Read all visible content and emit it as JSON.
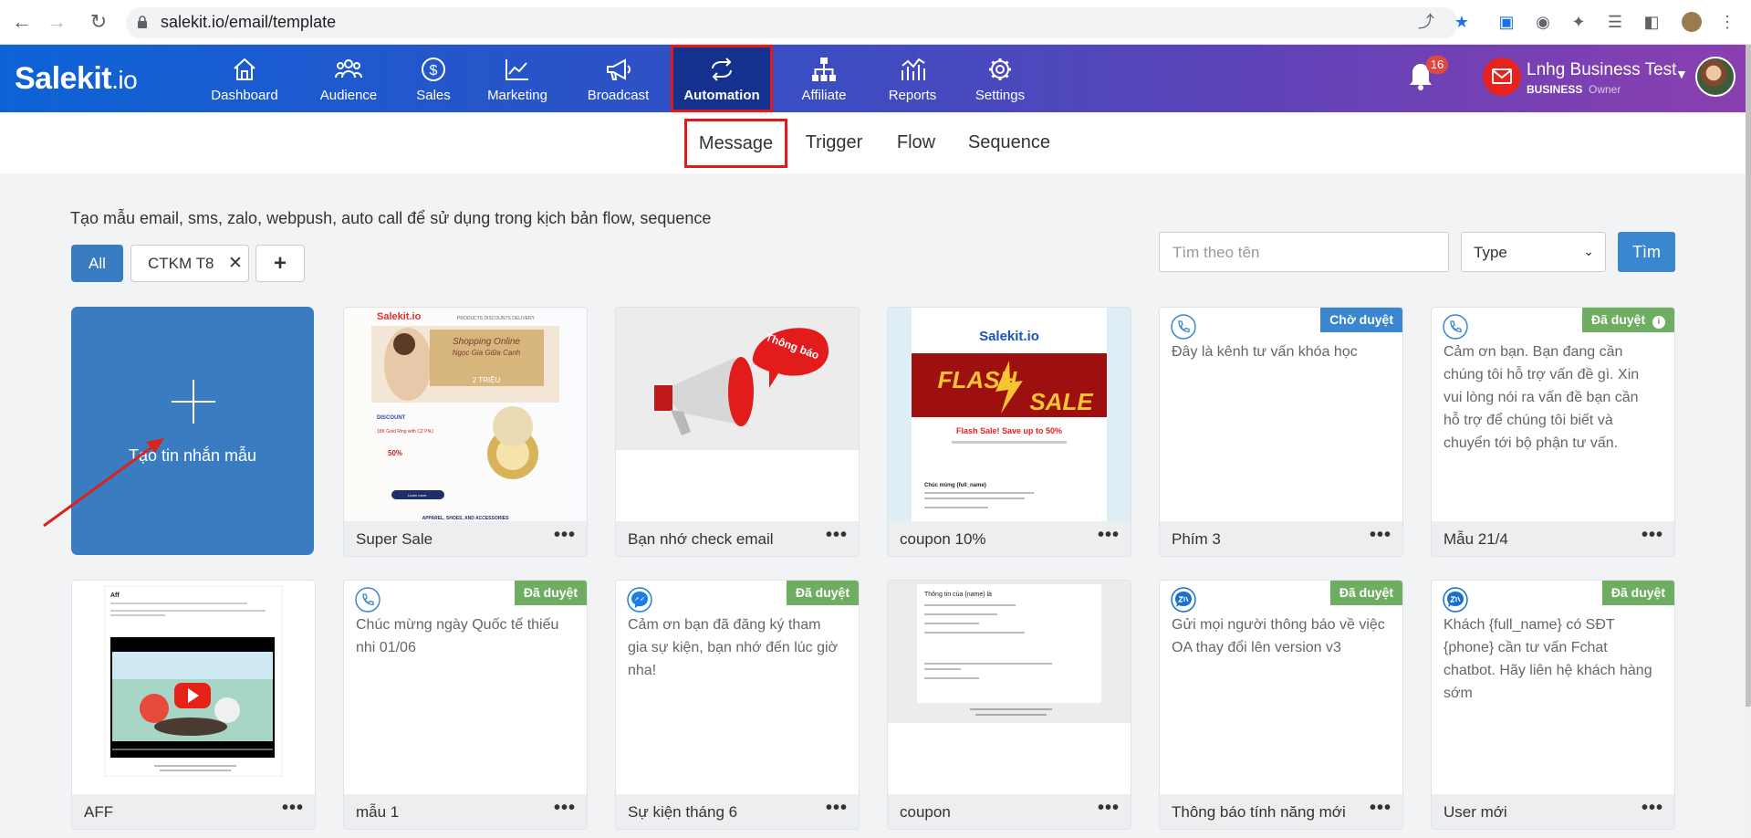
{
  "browser": {
    "url": "salekit.io/email/template"
  },
  "app": {
    "logo": "Salekit",
    "logo_suffix": ".io",
    "nav": [
      {
        "label": "Dashboard",
        "icon": "home-icon"
      },
      {
        "label": "Audience",
        "icon": "users-icon"
      },
      {
        "label": "Sales",
        "icon": "dollar-icon"
      },
      {
        "label": "Marketing",
        "icon": "chart-line-icon"
      },
      {
        "label": "Broadcast",
        "icon": "megaphone-icon"
      },
      {
        "label": "Automation",
        "icon": "repeat-icon",
        "active": true
      },
      {
        "label": "Affiliate",
        "icon": "network-icon"
      },
      {
        "label": "Reports",
        "icon": "bar-chart-icon"
      },
      {
        "label": "Settings",
        "icon": "gear-icon"
      }
    ],
    "notifications_count": "16",
    "account": {
      "name": "Lnhg Business Test",
      "plan": "BUSINESS",
      "role": "Owner"
    }
  },
  "subnav": {
    "tabs": [
      {
        "label": "Message",
        "active": true
      },
      {
        "label": "Trigger"
      },
      {
        "label": "Flow"
      },
      {
        "label": "Sequence"
      }
    ]
  },
  "toolbar": {
    "description": "Tạo mẫu email, sms, zalo, webpush, auto call để sử dụng trong kịch bản flow, sequence",
    "filter_all": "All",
    "filter_tag": "CTKM T8",
    "filter_add": "+",
    "search_placeholder": "Tìm theo tên",
    "type_select": "Type",
    "search_button": "Tìm"
  },
  "create_card": {
    "label": "Tạo tin nhắn mẫu"
  },
  "templates": [
    {
      "name": "Super Sale",
      "kind": "email-image",
      "preview": {
        "logo": "Salekit.io",
        "menu": "PRODUCTS   DISCOUNTS   DELIVERY",
        "script": "Shopping Online",
        "sub": "Ngọc Gia Giữa Cạnh",
        "price": "2 TRIỆU",
        "discount": "DISCOUNT",
        "product": "18K Gold Ring with CZ PNJ",
        "percent": "50%",
        "btn": "Learn more",
        "footer": "APPAREL, SHOES, AND ACCESSORIES"
      }
    },
    {
      "name": "Bạn nhớ check email",
      "kind": "email-image",
      "preview": {
        "bubble": "Thông báo"
      }
    },
    {
      "name": "coupon 10%",
      "kind": "email-image",
      "preview": {
        "logo": "Salekit.io",
        "flash": "FLASH",
        "sale": "SALE",
        "headline": "Flash Sale! Save up to 50%",
        "greeting": "Chúc mừng {full_name}"
      }
    },
    {
      "name": "Phím 3",
      "kind": "call",
      "status": "Chờ duyệt",
      "text": "Đây là kênh tư vấn khóa học"
    },
    {
      "name": "Mẫu 21/4",
      "kind": "call",
      "status": "Đã duyệt",
      "text": "Cảm ơn bạn. Bạn đang cần chúng tôi hỗ trợ vấn đề gì. Xin vui lòng nói ra vấn đề bạn cần hỗ trợ để chúng tôi biết và chuyển tới bộ phận tư vấn."
    },
    {
      "name": "AFF",
      "kind": "email-image",
      "preview": {
        "title": "Aff"
      }
    },
    {
      "name": "mẫu 1",
      "kind": "call",
      "status": "Đã duyệt",
      "text": "Chúc mừng ngày Quốc tế thiếu nhi 01/06"
    },
    {
      "name": "Sự kiện tháng 6",
      "kind": "messenger",
      "status": "Đã duyệt",
      "text": "Cảm ơn bạn đã đăng ký tham gia sự kiện, bạn nhớ đến lúc giờ nha!"
    },
    {
      "name": "coupon",
      "kind": "email-image",
      "preview": {
        "title": "Thông tin của {name} là"
      }
    },
    {
      "name": "Thông báo tính năng mới",
      "kind": "zalo",
      "status": "Đã duyệt",
      "text": "Gửi mọi người thông báo về việc OA thay đổi lên version v3"
    },
    {
      "name": "User mới",
      "kind": "zalo",
      "status": "Đã duyệt",
      "text": "Khách {full_name} có SĐT {phone} cần tư vấn Fchat chatbot. Hãy liên hệ khách hàng sớm"
    }
  ],
  "colors": {
    "nav_start": "#0d63d6",
    "nav_end": "#8b3fb0",
    "primary": "#3a7cc2",
    "badge_pending": "#3a87cf",
    "badge_approved": "#6fae62",
    "highlight": "#e01b1b"
  }
}
